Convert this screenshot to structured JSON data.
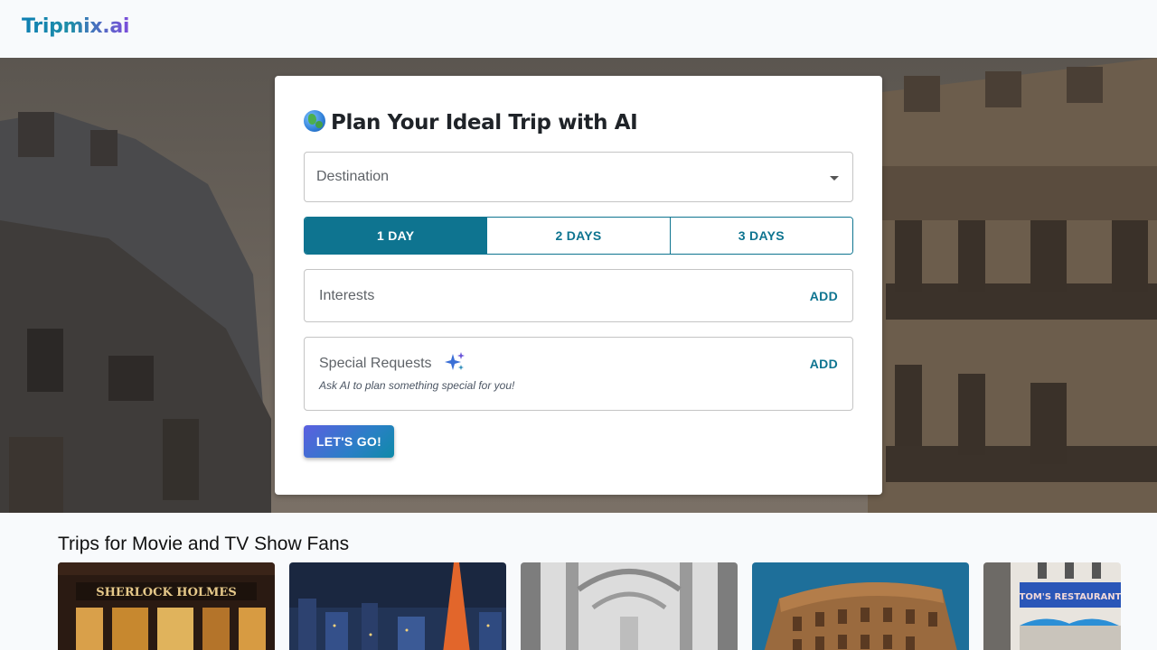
{
  "header": {
    "logo": "Tripmix.ai"
  },
  "planner": {
    "title": "Plan Your Ideal Trip with AI",
    "title_icon": "globe-icon",
    "destination": {
      "label": "Destination",
      "value": ""
    },
    "days": [
      {
        "label": "1 DAY",
        "selected": true
      },
      {
        "label": "2 DAYS",
        "selected": false
      },
      {
        "label": "3 DAYS",
        "selected": false
      }
    ],
    "interests": {
      "label": "Interests",
      "action": "ADD"
    },
    "special_requests": {
      "label": "Special Requests",
      "action": "ADD",
      "hint": "Ask AI to plan something special for you!",
      "icon": "sparkle-icon"
    },
    "submit_label": "LET'S GO!"
  },
  "section": {
    "title": "Trips for Movie and TV Show Fans",
    "cards": [
      {
        "image": "sherlock-holmes-pub",
        "sign": "SHERLOCK HOLMES"
      },
      {
        "image": "tokyo-night-skyline"
      },
      {
        "image": "paris-bir-hakeim-bridge"
      },
      {
        "image": "rome-colosseum"
      },
      {
        "image": "toms-restaurant-new-york",
        "sign": "TOM'S RESTAURANT"
      }
    ]
  },
  "colors": {
    "accent": "#0e7490",
    "button_gradient_start": "#5b5fe0",
    "button_gradient_end": "#0f8aa8",
    "logo_gradient_start": "#0e7fb3",
    "logo_gradient_end": "#7c4ddb"
  }
}
